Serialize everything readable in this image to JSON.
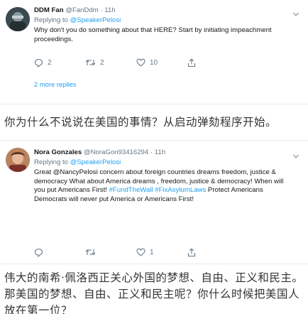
{
  "tweet1": {
    "display_name": "DDM Fan",
    "handle": "@FanDdm",
    "separator": "·",
    "time": "11h",
    "replying_prefix": "Replying to ",
    "replying_to": "@SpeakerPelosi",
    "text": "Why don't you do something about that HERE?  Start by initiating impeachment proceedings.",
    "reply_count": "2",
    "retweet_count": "2",
    "like_count": "10",
    "more_replies": "2 more replies"
  },
  "caption1": "你为什么不说说在美国的事情？从启动弹劾程序开始。",
  "tweet2": {
    "display_name": "Nora Gonzales",
    "handle": "@NoraGon93416294",
    "separator": "·",
    "time": "11h",
    "replying_prefix": "Replying to ",
    "replying_to": "@SpeakerPelosi",
    "text_part1": "Great @NancyPelosi concern about foreign countries dreams freedom, justice & democracy What about America dreams , freedom, justice & democracy! When will you put Americans First! ",
    "hashtag1": "#FundTheWall",
    "hashtag2": "#FixAsylumLaws",
    "text_part2": " Protect Americans Democrats will never put America or Americans First!",
    "reply_count": "",
    "retweet_count": "",
    "like_count": "1"
  },
  "caption2": "伟大的南希·佩洛西正关心外国的梦想、自由、正义和民主。那美国的梦想、自由、正义和民主呢？你什么时候把美国人放在第一位？",
  "colors": {
    "link": "#1da1f2",
    "secondary_text": "#657786",
    "divider": "#e6ecf0"
  },
  "icons": [
    "avatar",
    "chevron-down-icon",
    "reply-icon",
    "retweet-icon",
    "like-icon",
    "share-icon"
  ]
}
